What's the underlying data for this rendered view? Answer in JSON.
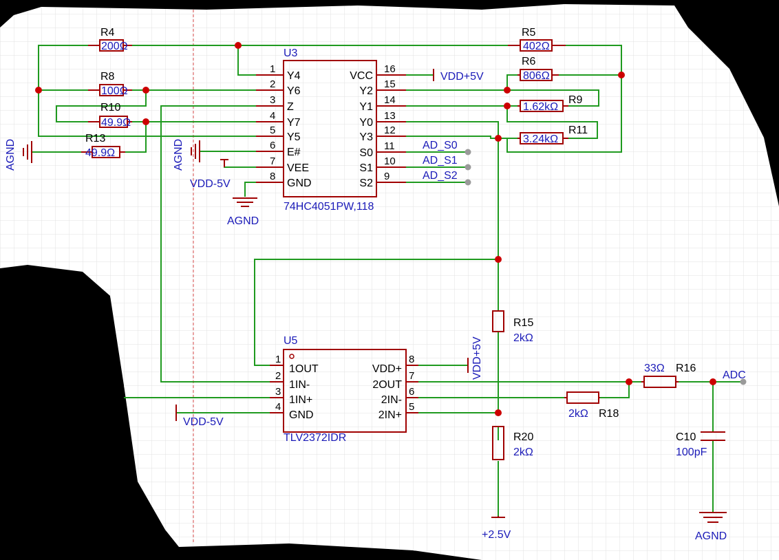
{
  "components": {
    "u3": {
      "ref": "U3",
      "part": "74HC4051PW,118",
      "left_pins": [
        {
          "num": "1",
          "name": "Y4"
        },
        {
          "num": "2",
          "name": "Y6"
        },
        {
          "num": "3",
          "name": "Z"
        },
        {
          "num": "4",
          "name": "Y7"
        },
        {
          "num": "5",
          "name": "Y5"
        },
        {
          "num": "6",
          "name": "E#"
        },
        {
          "num": "7",
          "name": "VEE"
        },
        {
          "num": "8",
          "name": "GND"
        }
      ],
      "right_pins": [
        {
          "num": "16",
          "name": "VCC"
        },
        {
          "num": "15",
          "name": "Y2"
        },
        {
          "num": "14",
          "name": "Y1"
        },
        {
          "num": "13",
          "name": "Y0"
        },
        {
          "num": "12",
          "name": "Y3"
        },
        {
          "num": "11",
          "name": "S0"
        },
        {
          "num": "10",
          "name": "S1"
        },
        {
          "num": "9",
          "name": "S2"
        }
      ]
    },
    "u5": {
      "ref": "U5",
      "part": "TLV2372IDR",
      "left_pins": [
        {
          "num": "1",
          "name": "1OUT"
        },
        {
          "num": "2",
          "name": "1IN-"
        },
        {
          "num": "3",
          "name": "1IN+"
        },
        {
          "num": "4",
          "name": "GND"
        }
      ],
      "right_pins": [
        {
          "num": "8",
          "name": "VDD+"
        },
        {
          "num": "7",
          "name": "2OUT"
        },
        {
          "num": "6",
          "name": "2IN-"
        },
        {
          "num": "5",
          "name": "2IN+"
        }
      ]
    },
    "r4": {
      "ref": "R4",
      "value": "200Ω"
    },
    "r8": {
      "ref": "R8",
      "value": "100Ω"
    },
    "r10": {
      "ref": "R10",
      "value": "49.9Ω"
    },
    "r13": {
      "ref": "R13",
      "value": "49.9Ω"
    },
    "r5": {
      "ref": "R5",
      "value": "402Ω"
    },
    "r6": {
      "ref": "R6",
      "value": "806Ω"
    },
    "r9": {
      "ref": "R9",
      "value": "1.62kΩ"
    },
    "r11": {
      "ref": "R11",
      "value": "3.24kΩ"
    },
    "r15": {
      "ref": "R15",
      "value": "2kΩ"
    },
    "r20": {
      "ref": "R20",
      "value": "2kΩ"
    },
    "r16": {
      "ref": "R16",
      "value": "33Ω"
    },
    "r18": {
      "ref": "R18",
      "value": "2kΩ"
    },
    "c10": {
      "ref": "C10",
      "value": "100pF"
    }
  },
  "nets": {
    "agnd": "AGND",
    "vdd_pos": "VDD+5V",
    "vdd_neg": "VDD-5V",
    "v25": "+2.5V",
    "ad_s0": "AD_S0",
    "ad_s1": "AD_S1",
    "ad_s2": "AD_S2",
    "adc": "ADC"
  },
  "colors": {
    "wire": "#1f9a1f",
    "component": "#a00000",
    "label": "#1a1ab8",
    "junction": "#cc0000",
    "grid": "#e2e2e2"
  }
}
